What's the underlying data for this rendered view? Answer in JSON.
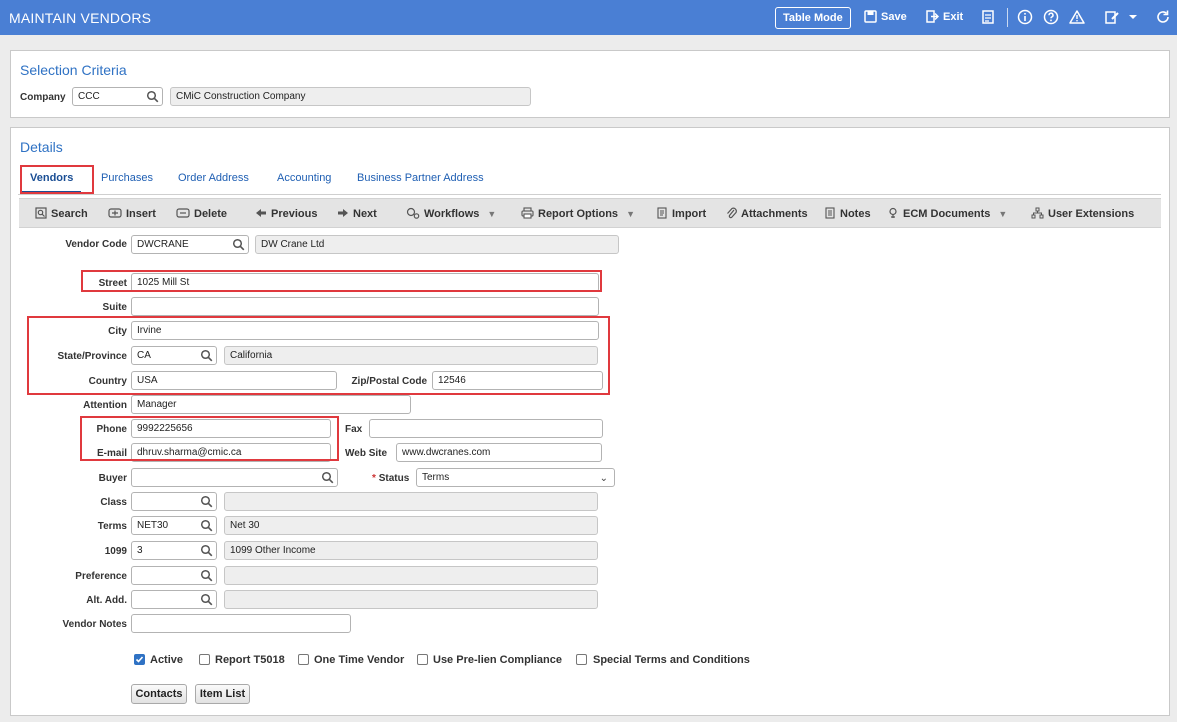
{
  "header": {
    "title": "MAINTAIN VENDORS",
    "table_mode_label": "Table Mode",
    "save_label": "Save",
    "exit_label": "Exit"
  },
  "selection": {
    "section_title": "Selection Criteria",
    "company_label": "Company",
    "company_code": "CCC",
    "company_name": "CMiC Construction Company"
  },
  "details": {
    "section_title": "Details",
    "tabs": [
      {
        "label": "Vendors"
      },
      {
        "label": "Purchases"
      },
      {
        "label": "Order Address"
      },
      {
        "label": "Accounting"
      },
      {
        "label": "Business Partner Address"
      }
    ]
  },
  "toolbar": {
    "search": "Search",
    "insert": "Insert",
    "delete": "Delete",
    "previous": "Previous",
    "next": "Next",
    "workflows": "Workflows",
    "report_options": "Report Options",
    "import": "Import",
    "attachments": "Attachments",
    "notes": "Notes",
    "ecm_documents": "ECM Documents",
    "user_extensions": "User Extensions"
  },
  "form": {
    "vendor_code": {
      "label": "Vendor Code",
      "value": "DWCRANE",
      "name": "DW Crane Ltd"
    },
    "street": {
      "label": "Street",
      "value": "1025 Mill St"
    },
    "suite": {
      "label": "Suite",
      "value": ""
    },
    "city": {
      "label": "City",
      "value": "Irvine"
    },
    "state": {
      "label": "State/Province",
      "value": "CA",
      "name": "California"
    },
    "country": {
      "label": "Country",
      "value": "USA"
    },
    "zip": {
      "label": "Zip/Postal Code",
      "value": "12546"
    },
    "attention": {
      "label": "Attention",
      "value": "Manager"
    },
    "phone": {
      "label": "Phone",
      "value": "9992225656"
    },
    "fax": {
      "label": "Fax",
      "value": ""
    },
    "email": {
      "label": "E-mail",
      "value": "dhruv.sharma@cmic.ca"
    },
    "website": {
      "label": "Web Site",
      "value": "www.dwcranes.com"
    },
    "buyer": {
      "label": "Buyer",
      "value": ""
    },
    "status": {
      "label": "Status",
      "required_mark": "*",
      "value": "Terms"
    },
    "class": {
      "label": "Class",
      "value": "",
      "name": ""
    },
    "terms": {
      "label": "Terms",
      "value": "NET30",
      "name": "Net 30"
    },
    "f1099": {
      "label": "1099",
      "value": "3",
      "name": "1099 Other Income"
    },
    "preference": {
      "label": "Preference",
      "value": "",
      "name": ""
    },
    "alt_add": {
      "label": "Alt. Add.",
      "value": "",
      "name": ""
    },
    "vendor_notes": {
      "label": "Vendor Notes",
      "value": ""
    }
  },
  "checkboxes": [
    {
      "label": "Active",
      "checked": true
    },
    {
      "label": "Report T5018",
      "checked": false
    },
    {
      "label": "One Time Vendor",
      "checked": false
    },
    {
      "label": "Use Pre-lien Compliance",
      "checked": false
    },
    {
      "label": "Special Terms and Conditions",
      "checked": false
    }
  ],
  "buttons": {
    "contacts": "Contacts",
    "item_list": "Item List"
  }
}
